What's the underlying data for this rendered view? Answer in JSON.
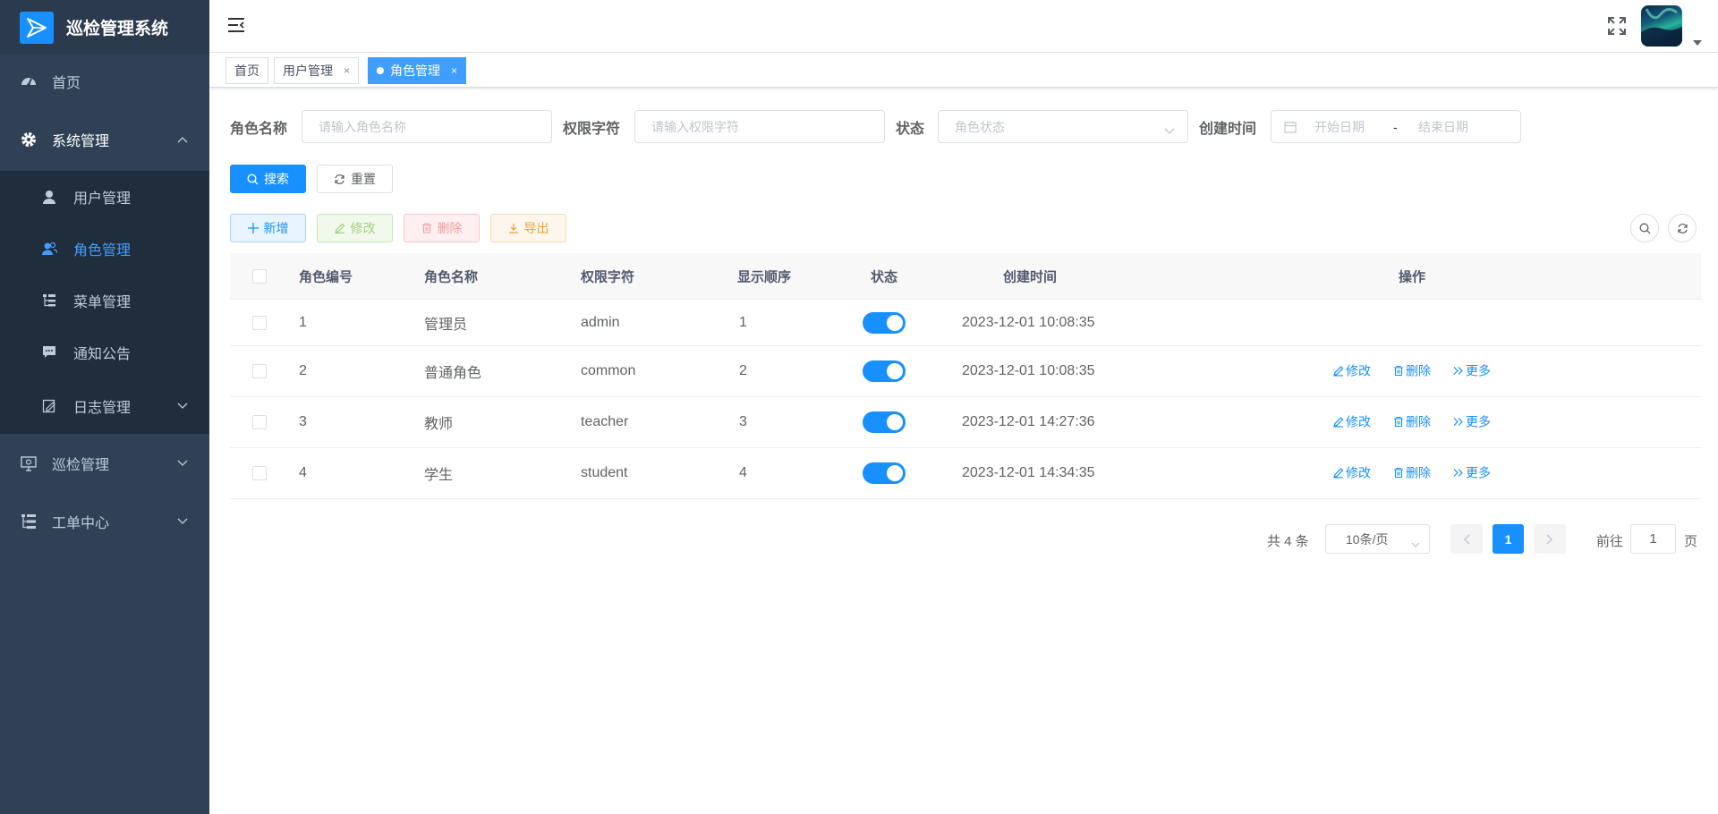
{
  "app": {
    "title": "巡检管理系统"
  },
  "sidebar": {
    "home": "首页",
    "system": {
      "label": "系统管理",
      "children": [
        "用户管理",
        "角色管理",
        "菜单管理",
        "通知公告",
        "日志管理"
      ]
    },
    "inspection": "巡检管理",
    "workorder": "工单中心"
  },
  "tags": [
    {
      "label": "首页"
    },
    {
      "label": "用户管理",
      "close": "×"
    },
    {
      "label": "角色管理",
      "close": "×"
    }
  ],
  "search": {
    "role_name_label": "角色名称",
    "role_name_placeholder": "请输入角色名称",
    "perm_label": "权限字符",
    "perm_placeholder": "请输入权限字符",
    "status_label": "状态",
    "status_placeholder": "角色状态",
    "created_label": "创建时间",
    "start_placeholder": "开始日期",
    "range_sep": "-",
    "end_placeholder": "结束日期",
    "search_btn": "搜索",
    "reset_btn": "重置"
  },
  "toolbar": {
    "add": "新增",
    "edit": "修改",
    "delete": "删除",
    "export": "导出"
  },
  "table": {
    "headers": [
      "角色编号",
      "角色名称",
      "权限字符",
      "显示顺序",
      "状态",
      "创建时间",
      "操作"
    ],
    "rows": [
      {
        "id": "1",
        "name": "管理员",
        "key": "admin",
        "order": "1",
        "enabled": true,
        "created": "2023-12-01 10:08:35",
        "ops": false
      },
      {
        "id": "2",
        "name": "普通角色",
        "key": "common",
        "order": "2",
        "enabled": true,
        "created": "2023-12-01 10:08:35",
        "ops": true
      },
      {
        "id": "3",
        "name": "教师",
        "key": "teacher",
        "order": "3",
        "enabled": true,
        "created": "2023-12-01 14:27:36",
        "ops": true
      },
      {
        "id": "4",
        "name": "学生",
        "key": "student",
        "order": "4",
        "enabled": true,
        "created": "2023-12-01 14:34:35",
        "ops": true
      }
    ],
    "op_labels": {
      "edit": "修改",
      "delete": "删除",
      "more": "更多"
    }
  },
  "pagination": {
    "total": "共 4 条",
    "page_size": "10条/页",
    "current": "1",
    "goto_prefix": "前往",
    "goto_value": "1",
    "goto_suffix": "页"
  },
  "colors": {
    "sidebar_bg": "#304156",
    "submenu_bg": "#1f2d3d",
    "primary": "#1890ff",
    "active_text": "#409eff"
  }
}
